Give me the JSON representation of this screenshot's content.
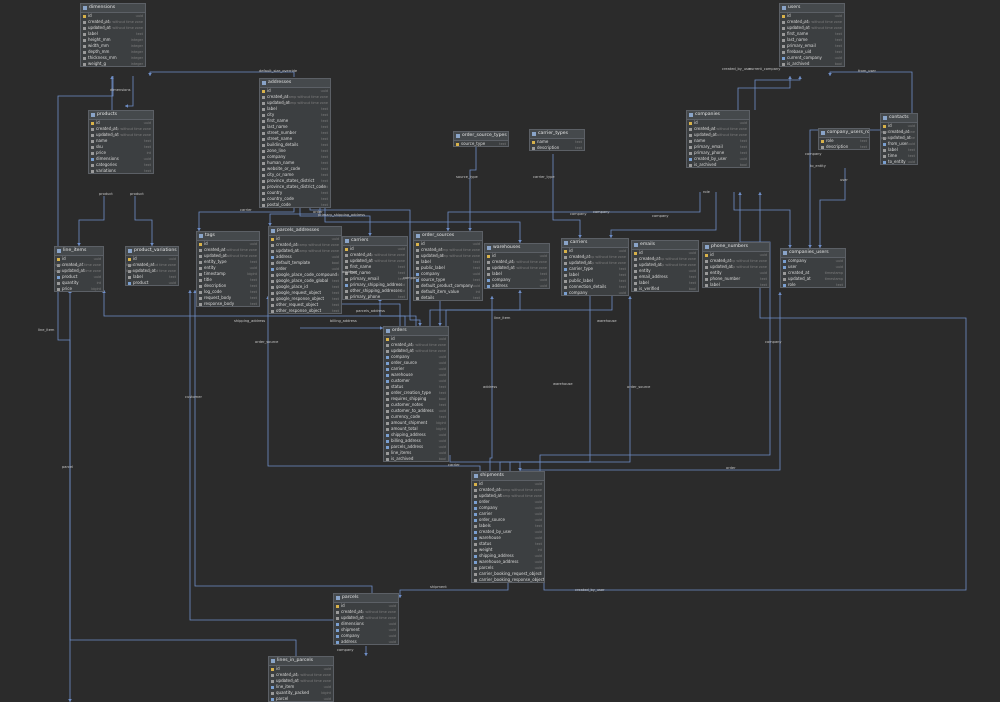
{
  "colors": {
    "background": "#2b2b2b",
    "table": "#3c3f41",
    "border": "#5c6066",
    "wire": "#6f8fc9",
    "pk": "#d8b24a",
    "fk": "#7a9fd0"
  },
  "tables": [
    {
      "name": "dimensions",
      "cols": [
        [
          "id",
          "uuid",
          "pk"
        ],
        [
          "created_at",
          "timestamp without time zone",
          ""
        ],
        [
          "updated_at",
          "timestamp without time zone",
          ""
        ],
        [
          "label",
          "text",
          ""
        ],
        [
          "height_mm",
          "integer",
          ""
        ],
        [
          "width_mm",
          "integer",
          ""
        ],
        [
          "depth_mm",
          "integer",
          ""
        ],
        [
          "thickness_mm",
          "integer",
          ""
        ],
        [
          "weight_g",
          "integer",
          ""
        ]
      ]
    },
    {
      "name": "users",
      "cols": [
        [
          "id",
          "uuid",
          "pk"
        ],
        [
          "created_at",
          "timestamp without time zone",
          ""
        ],
        [
          "updated_at",
          "timestamp without time zone",
          ""
        ],
        [
          "first_name",
          "text",
          ""
        ],
        [
          "last_name",
          "text",
          ""
        ],
        [
          "primary_email",
          "text",
          ""
        ],
        [
          "firebase_uid",
          "text",
          ""
        ],
        [
          "current_company",
          "uuid",
          "fk"
        ],
        [
          "is_archived",
          "bool",
          ""
        ]
      ]
    },
    {
      "name": "addresses",
      "cols": [
        [
          "id",
          "uuid",
          "pk"
        ],
        [
          "created_at",
          "timestamp without time zone",
          ""
        ],
        [
          "updated_at",
          "timestamp without time zone",
          ""
        ],
        [
          "label",
          "text",
          ""
        ],
        [
          "city",
          "text",
          ""
        ],
        [
          "first_name",
          "text",
          ""
        ],
        [
          "last_name",
          "text",
          ""
        ],
        [
          "street_number",
          "text",
          ""
        ],
        [
          "street_name",
          "text",
          ""
        ],
        [
          "building_details",
          "text",
          ""
        ],
        [
          "zone_line",
          "text",
          ""
        ],
        [
          "company",
          "text",
          ""
        ],
        [
          "human_name",
          "text",
          ""
        ],
        [
          "website_or_code",
          "text",
          ""
        ],
        [
          "city_or_name",
          "text",
          ""
        ],
        [
          "province_states_district",
          "text",
          ""
        ],
        [
          "province_states_district_code",
          "text",
          ""
        ],
        [
          "country",
          "text",
          ""
        ],
        [
          "country_code",
          "text",
          ""
        ],
        [
          "postal_code",
          "text",
          ""
        ]
      ]
    },
    {
      "name": "products",
      "cols": [
        [
          "id",
          "uuid",
          "pk"
        ],
        [
          "created_at",
          "timestamp without time zone",
          ""
        ],
        [
          "updated_at",
          "timestamp without time zone",
          ""
        ],
        [
          "name",
          "text",
          ""
        ],
        [
          "sku",
          "text",
          ""
        ],
        [
          "price",
          "int",
          ""
        ],
        [
          "dimensions",
          "uuid",
          "fk"
        ],
        [
          "categories",
          "text",
          ""
        ],
        [
          "variations",
          "text",
          ""
        ]
      ]
    },
    {
      "name": "order_source_types",
      "cols": [
        [
          "source_type",
          "text",
          "pk"
        ]
      ]
    },
    {
      "name": "carrier_types",
      "cols": [
        [
          "name",
          "text",
          "pk"
        ],
        [
          "description",
          "text",
          ""
        ]
      ]
    },
    {
      "name": "companies",
      "cols": [
        [
          "id",
          "uuid",
          "pk"
        ],
        [
          "created_at",
          "timestamp without time zone",
          ""
        ],
        [
          "updated_at",
          "timestamp without time zone",
          ""
        ],
        [
          "name",
          "text",
          ""
        ],
        [
          "primary_email",
          "text",
          ""
        ],
        [
          "primary_phone",
          "text",
          ""
        ],
        [
          "created_by_user",
          "uuid",
          "fk"
        ],
        [
          "is_archived",
          "bool",
          ""
        ]
      ]
    },
    {
      "name": "company_users_roles",
      "cols": [
        [
          "role",
          "text",
          "pk"
        ],
        [
          "description",
          "text",
          ""
        ]
      ]
    },
    {
      "name": "contacts",
      "cols": [
        [
          "id",
          "uuid",
          "pk"
        ],
        [
          "created_at",
          "timestamp without time zone",
          ""
        ],
        [
          "updated_at",
          "timestamp without time zone",
          ""
        ],
        [
          "from_user",
          "uuid",
          "fk"
        ],
        [
          "label",
          "text",
          ""
        ],
        [
          "time",
          "text",
          ""
        ],
        [
          "to_entity",
          "uuid",
          "fk"
        ]
      ]
    },
    {
      "name": "line_items",
      "cols": [
        [
          "id",
          "uuid",
          "pk"
        ],
        [
          "created_at",
          "timestamp without time zone",
          ""
        ],
        [
          "updated_at",
          "timestamp without time zone",
          ""
        ],
        [
          "product",
          "uuid",
          "fk"
        ],
        [
          "quantity",
          "int",
          ""
        ],
        [
          "price",
          "bigint",
          ""
        ]
      ]
    },
    {
      "name": "product_variations",
      "cols": [
        [
          "id",
          "uuid",
          "pk"
        ],
        [
          "created_at",
          "timestamp without time zone",
          ""
        ],
        [
          "updated_at",
          "timestamp without time zone",
          ""
        ],
        [
          "label",
          "text",
          ""
        ],
        [
          "product",
          "uuid",
          "fk"
        ]
      ]
    },
    {
      "name": "tags",
      "cols": [
        [
          "id",
          "uuid",
          "pk"
        ],
        [
          "created_at",
          "timestamp without time zone",
          ""
        ],
        [
          "updated_at",
          "timestamp without time zone",
          ""
        ],
        [
          "entity_type",
          "text",
          ""
        ],
        [
          "entity",
          "uuid",
          ""
        ],
        [
          "timestamp",
          "bigint",
          ""
        ],
        [
          "title",
          "text",
          ""
        ],
        [
          "description",
          "text",
          ""
        ],
        [
          "log_code",
          "text",
          ""
        ],
        [
          "request_body",
          "text",
          ""
        ],
        [
          "response_body",
          "text",
          ""
        ]
      ]
    },
    {
      "name": "parcels_addresses",
      "cols": [
        [
          "id",
          "uuid",
          "pk"
        ],
        [
          "created_at",
          "timestamp without time zone",
          ""
        ],
        [
          "updated_at",
          "timestamp without time zone",
          ""
        ],
        [
          "address",
          "uuid",
          "fk"
        ],
        [
          "default_template",
          "bool",
          ""
        ],
        [
          "order",
          "uuid",
          "fk"
        ],
        [
          "google_place_code_compound",
          "text",
          ""
        ],
        [
          "google_place_code_global",
          "text",
          ""
        ],
        [
          "google_place_id",
          "text",
          ""
        ],
        [
          "google_request_object",
          "text",
          ""
        ],
        [
          "google_response_object",
          "text",
          ""
        ],
        [
          "other_request_object",
          "text",
          ""
        ],
        [
          "other_response_object",
          "text",
          ""
        ]
      ]
    },
    {
      "name": "carriers",
      "cols": [
        [
          "id",
          "uuid",
          "pk"
        ],
        [
          "created_at",
          "timestamp without time zone",
          ""
        ],
        [
          "updated_at",
          "timestamp without time zone",
          ""
        ],
        [
          "first_name",
          "text",
          ""
        ],
        [
          "last_name",
          "text",
          ""
        ],
        [
          "primary_email",
          "text",
          ""
        ],
        [
          "primary_shipping_address",
          "uuid",
          "fk"
        ],
        [
          "other_shipping_addresses",
          "uuid",
          ""
        ],
        [
          "primary_phone",
          "text",
          ""
        ]
      ]
    },
    {
      "name": "order_sources",
      "cols": [
        [
          "id",
          "uuid",
          "pk"
        ],
        [
          "created_at",
          "timestamp without time zone",
          ""
        ],
        [
          "updated_at",
          "timestamp without time zone",
          ""
        ],
        [
          "label",
          "text",
          ""
        ],
        [
          "public_label",
          "text",
          ""
        ],
        [
          "company",
          "uuid",
          "fk"
        ],
        [
          "source_type",
          "text",
          "fk"
        ],
        [
          "default_product_company",
          "uuid",
          ""
        ],
        [
          "default_item_value",
          "int",
          ""
        ],
        [
          "details",
          "text",
          ""
        ]
      ]
    },
    {
      "name": "warehouses",
      "cols": [
        [
          "id",
          "uuid",
          "pk"
        ],
        [
          "created_at",
          "timestamp without time zone",
          ""
        ],
        [
          "updated_at",
          "timestamp without time zone",
          ""
        ],
        [
          "label",
          "text",
          ""
        ],
        [
          "company",
          "uuid",
          "fk"
        ],
        [
          "address",
          "uuid",
          "fk"
        ]
      ]
    },
    {
      "name": "carriers",
      "cols": [
        [
          "id",
          "uuid",
          "pk"
        ],
        [
          "created_at",
          "timestamp without time zone",
          ""
        ],
        [
          "updated_at",
          "timestamp without time zone",
          ""
        ],
        [
          "carrier_type",
          "text",
          "fk"
        ],
        [
          "label",
          "text",
          ""
        ],
        [
          "public_label",
          "text",
          ""
        ],
        [
          "connection_details",
          "text",
          ""
        ],
        [
          "company",
          "uuid",
          "fk"
        ]
      ]
    },
    {
      "name": "emails",
      "cols": [
        [
          "id",
          "uuid",
          "pk"
        ],
        [
          "created_at",
          "timestamp without time zone",
          ""
        ],
        [
          "updated_at",
          "timestamp without time zone",
          ""
        ],
        [
          "entity",
          "uuid",
          ""
        ],
        [
          "email_address",
          "text",
          ""
        ],
        [
          "label",
          "text",
          ""
        ],
        [
          "is_verified",
          "bool",
          ""
        ]
      ]
    },
    {
      "name": "phone_numbers",
      "cols": [
        [
          "id",
          "uuid",
          "pk"
        ],
        [
          "created_at",
          "timestamp without time zone",
          ""
        ],
        [
          "updated_at",
          "timestamp without time zone",
          ""
        ],
        [
          "entity",
          "uuid",
          ""
        ],
        [
          "phone_number",
          "text",
          ""
        ],
        [
          "label",
          "text",
          ""
        ]
      ]
    },
    {
      "name": "companies_users",
      "cols": [
        [
          "company",
          "uuid",
          "fk"
        ],
        [
          "user",
          "uuid",
          "fk"
        ],
        [
          "created_at",
          "timestamp",
          ""
        ],
        [
          "updated_at",
          "timestamp",
          ""
        ],
        [
          "role",
          "text",
          "fk"
        ]
      ]
    },
    {
      "name": "orders",
      "cols": [
        [
          "id",
          "uuid",
          "pk"
        ],
        [
          "created_at",
          "timestamp without time zone",
          ""
        ],
        [
          "updated_at",
          "timestamp without time zone",
          ""
        ],
        [
          "company",
          "uuid",
          "fk"
        ],
        [
          "order_source",
          "uuid",
          "fk"
        ],
        [
          "carrier",
          "uuid",
          "fk"
        ],
        [
          "warehouse",
          "uuid",
          "fk"
        ],
        [
          "customer",
          "uuid",
          "fk"
        ],
        [
          "status",
          "text",
          ""
        ],
        [
          "order_creation_type",
          "text",
          ""
        ],
        [
          "requires_shipping",
          "bool",
          ""
        ],
        [
          "customer_notes",
          "text",
          ""
        ],
        [
          "customer_to_address",
          "uuid",
          ""
        ],
        [
          "currency_code",
          "text",
          ""
        ],
        [
          "amount_shipment",
          "bigint",
          ""
        ],
        [
          "amount_total",
          "bigint",
          ""
        ],
        [
          "shipping_address",
          "uuid",
          "fk"
        ],
        [
          "billing_address",
          "uuid",
          "fk"
        ],
        [
          "parcels_address",
          "uuid",
          "fk"
        ],
        [
          "line_items",
          "uuid",
          ""
        ],
        [
          "is_archived",
          "bool",
          ""
        ]
      ]
    },
    {
      "name": "shipments",
      "cols": [
        [
          "id",
          "uuid",
          "pk"
        ],
        [
          "created_at",
          "timestamp without time zone",
          ""
        ],
        [
          "updated_at",
          "timestamp without time zone",
          ""
        ],
        [
          "order",
          "uuid",
          "fk"
        ],
        [
          "company",
          "uuid",
          "fk"
        ],
        [
          "carrier",
          "uuid",
          "fk"
        ],
        [
          "order_source",
          "uuid",
          "fk"
        ],
        [
          "labels",
          "text",
          ""
        ],
        [
          "created_by_user",
          "uuid",
          "fk"
        ],
        [
          "warehouse",
          "uuid",
          "fk"
        ],
        [
          "status",
          "text",
          ""
        ],
        [
          "weight",
          "int",
          ""
        ],
        [
          "shipping_address",
          "uuid",
          "fk"
        ],
        [
          "warehouse_address",
          "uuid",
          "fk"
        ],
        [
          "parcels",
          "uuid",
          ""
        ],
        [
          "carrier_booking_request_object",
          "text",
          ""
        ],
        [
          "carrier_booking_response_object",
          "text",
          ""
        ]
      ]
    },
    {
      "name": "parcels",
      "cols": [
        [
          "id",
          "uuid",
          "pk"
        ],
        [
          "created_at",
          "timestamp without time zone",
          ""
        ],
        [
          "updated_at",
          "timestamp without time zone",
          ""
        ],
        [
          "dimensions",
          "uuid",
          "fk"
        ],
        [
          "shipment",
          "uuid",
          "fk"
        ],
        [
          "company",
          "uuid",
          "fk"
        ],
        [
          "address",
          "uuid",
          "fk"
        ]
      ]
    },
    {
      "name": "lines_in_parcels",
      "cols": [
        [
          "id",
          "uuid",
          "pk"
        ],
        [
          "created_at",
          "timestamp without time zone",
          ""
        ],
        [
          "updated_at",
          "timestamp without time zone",
          ""
        ],
        [
          "line_item",
          "uuid",
          "fk"
        ],
        [
          "quantity_packed",
          "bigint",
          ""
        ],
        [
          "parcel",
          "uuid",
          "fk"
        ]
      ]
    }
  ],
  "labels": [
    "default_size_override",
    "current_company",
    "created_by_user",
    "from_user",
    "dimensions",
    "product",
    "product",
    "source_type",
    "carrier_type",
    "to_entity",
    "company",
    "user",
    "role",
    "company",
    "company",
    "company",
    "primary_shipping_address",
    "address",
    "order",
    "carrier",
    "company",
    "shipping_address",
    "billing_address",
    "parcels_address",
    "line_item",
    "warehouse",
    "order_source",
    "carrier",
    "order_source",
    "warehouse",
    "address",
    "customer",
    "company",
    "order",
    "created_by_user",
    "shipment",
    "company",
    "parcel",
    "line_item",
    "dimensions"
  ]
}
